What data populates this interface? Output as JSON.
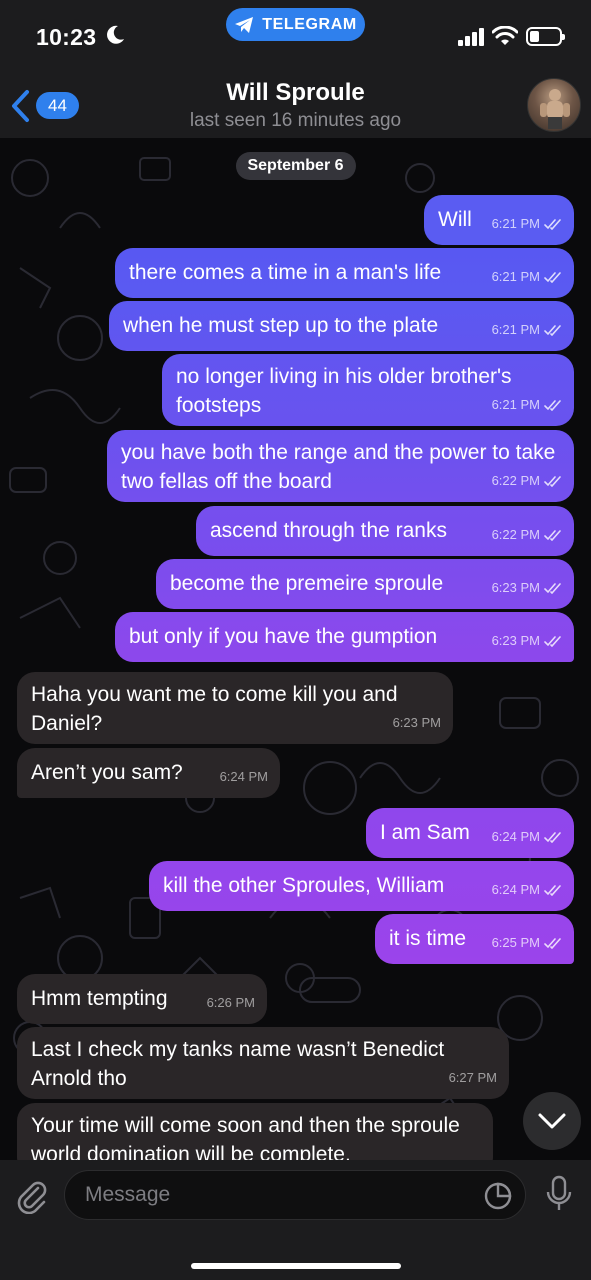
{
  "status": {
    "time": "10:23",
    "app_pill": "TELEGRAM"
  },
  "header": {
    "back_count": "44",
    "contact_name": "Will Sproule",
    "last_seen": "last seen 16 minutes ago"
  },
  "chat": {
    "date": "September 6",
    "messages": [
      {
        "dir": "out",
        "text": "Will",
        "time": "6:21 PM"
      },
      {
        "dir": "out",
        "text": "there comes a time in a man's life",
        "time": "6:21 PM"
      },
      {
        "dir": "out",
        "text": "when he must step up to the plate",
        "time": "6:21 PM"
      },
      {
        "dir": "out",
        "text": "no longer living in his older brother's footsteps",
        "time": "6:21 PM"
      },
      {
        "dir": "out",
        "text": "you have both the range and the power to take two fellas off the board",
        "time": "6:22 PM"
      },
      {
        "dir": "out",
        "text": "ascend through the ranks",
        "time": "6:22 PM"
      },
      {
        "dir": "out",
        "text": "become the premeire sproule",
        "time": "6:23 PM"
      },
      {
        "dir": "out",
        "text": "but only if you have the gumption",
        "time": "6:23 PM"
      },
      {
        "dir": "in",
        "text": "Haha you want me to come kill you and Daniel?",
        "time": "6:23 PM"
      },
      {
        "dir": "in",
        "text": "Aren’t you sam?",
        "time": "6:24 PM"
      },
      {
        "dir": "out",
        "text": "I am Sam",
        "time": "6:24 PM"
      },
      {
        "dir": "out",
        "text": "kill the other Sproules, William",
        "time": "6:24 PM"
      },
      {
        "dir": "out",
        "text": "it is time",
        "time": "6:25 PM"
      },
      {
        "dir": "in",
        "text": "Hmm tempting",
        "time": "6:26 PM"
      },
      {
        "dir": "in",
        "text": "Last I check my tanks name wasn’t Benedict Arnold tho",
        "time": "6:27 PM"
      },
      {
        "dir": "in",
        "text": "Your time will come soon and then the sproule world domination will be complete.",
        "time": ""
      }
    ]
  },
  "composer": {
    "placeholder": "Message"
  },
  "icons": {
    "moon": "moon-icon",
    "signal": "signal-icon",
    "wifi": "wifi-icon",
    "battery": "battery-icon",
    "back": "chevron-left-icon",
    "read": "double-check-icon",
    "scroll": "chevron-down-icon",
    "attach": "paperclip-icon",
    "sticker": "sticker-icon",
    "mic": "microphone-icon"
  },
  "colors": {
    "accent": "#2f80ed",
    "bubble_out_top": "#4f5ef3",
    "bubble_out_bottom": "#9a46ec",
    "bubble_in": "#2a2628"
  }
}
